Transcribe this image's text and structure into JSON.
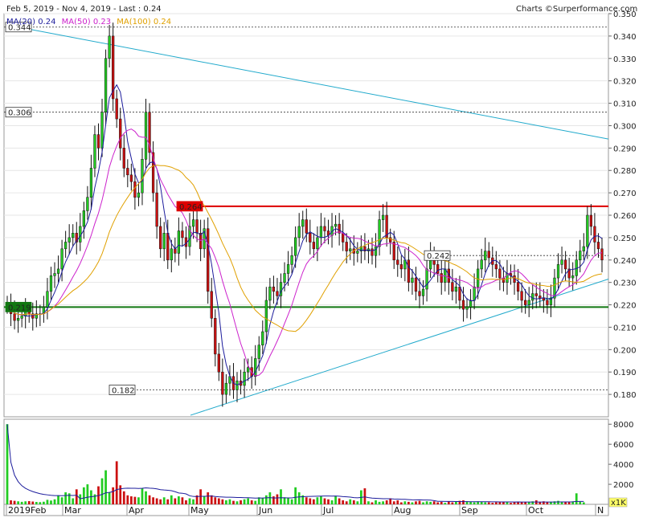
{
  "header": {
    "date_range": "Feb 5, 2019 - Nov 4, 2019 - Last : 0.24",
    "credit": "Charts",
    "site": "Surperformance.com",
    "ma20_label": "MA(20)",
    "ma20_value": "0.24",
    "ma50_label": "MA(50)",
    "ma50_value": "0.23",
    "ma100_label": "MA(100)",
    "ma100_value": "0.24"
  },
  "colors": {
    "ma20": "#1c1c9c",
    "ma50": "#cc22cc",
    "ma100": "#e0a000",
    "up_candle": "#22cc22",
    "down_candle": "#cc1111",
    "resistance": "#dd0000",
    "support": "#117711",
    "trend": "#22aacc"
  },
  "chart_data": {
    "type": "candlestick",
    "title": "Feb 5, 2019 - Nov 4, 2019 - Last : 0.24",
    "ylim": [
      0.17,
      0.35
    ],
    "y_ticks": [
      "0.350",
      "0.340",
      "0.330",
      "0.320",
      "0.310",
      "0.300",
      "0.290",
      "0.280",
      "0.270",
      "0.260",
      "0.250",
      "0.240",
      "0.230",
      "0.220",
      "0.210",
      "0.200",
      "0.190",
      "0.180"
    ],
    "x_labels": [
      "2019Feb",
      "Mar",
      "Apr",
      "May",
      "Jun",
      "Jul",
      "Aug",
      "Sep",
      "Oct",
      "N"
    ],
    "price_labels": [
      {
        "text": "0.344",
        "value": 0.344
      },
      {
        "text": "0.306",
        "value": 0.306
      },
      {
        "text": "0.264",
        "value": 0.264
      },
      {
        "text": "0.242",
        "value": 0.242
      },
      {
        "text": "0.219",
        "value": 0.219
      },
      {
        "text": "0.182",
        "value": 0.182
      }
    ],
    "close": [
      0.22,
      0.216,
      0.213,
      0.214,
      0.215,
      0.217,
      0.216,
      0.214,
      0.216,
      0.216,
      0.219,
      0.226,
      0.233,
      0.234,
      0.236,
      0.245,
      0.248,
      0.25,
      0.252,
      0.248,
      0.255,
      0.262,
      0.268,
      0.281,
      0.296,
      0.29,
      0.306,
      0.33,
      0.34,
      0.312,
      0.303,
      0.29,
      0.281,
      0.278,
      0.275,
      0.268,
      0.27,
      0.285,
      0.306,
      0.288,
      0.27,
      0.255,
      0.245,
      0.252,
      0.24,
      0.245,
      0.243,
      0.253,
      0.25,
      0.246,
      0.255,
      0.258,
      0.252,
      0.245,
      0.254,
      0.226,
      0.214,
      0.198,
      0.19,
      0.18,
      0.185,
      0.188,
      0.182,
      0.186,
      0.184,
      0.19,
      0.192,
      0.188,
      0.196,
      0.202,
      0.208,
      0.222,
      0.228,
      0.226,
      0.224,
      0.23,
      0.234,
      0.238,
      0.242,
      0.25,
      0.255,
      0.258,
      0.252,
      0.248,
      0.245,
      0.25,
      0.255,
      0.253,
      0.251,
      0.255,
      0.256,
      0.252,
      0.248,
      0.244,
      0.245,
      0.243,
      0.244,
      0.246,
      0.244,
      0.245,
      0.242,
      0.246,
      0.258,
      0.26,
      0.25,
      0.248,
      0.24,
      0.238,
      0.236,
      0.24,
      0.23,
      0.232,
      0.226,
      0.224,
      0.227,
      0.236,
      0.242,
      0.238,
      0.234,
      0.23,
      0.236,
      0.23,
      0.226,
      0.228,
      0.222,
      0.218,
      0.219,
      0.222,
      0.228,
      0.236,
      0.24,
      0.244,
      0.241,
      0.238,
      0.236,
      0.232,
      0.23,
      0.234,
      0.233,
      0.23,
      0.226,
      0.222,
      0.22,
      0.222,
      0.225,
      0.224,
      0.223,
      0.222,
      0.22,
      0.223,
      0.232,
      0.238,
      0.24,
      0.236,
      0.232,
      0.233,
      0.24,
      0.244,
      0.246,
      0.26,
      0.255,
      0.248,
      0.245,
      0.24
    ],
    "volume": [
      8000,
      400,
      350,
      300,
      250,
      300,
      320,
      280,
      240,
      220,
      260,
      450,
      380,
      500,
      900,
      700,
      1200,
      1100,
      600,
      1500,
      1000,
      1700,
      2000,
      1400,
      1000,
      1800,
      2600,
      3400,
      1200,
      1700,
      4300,
      1900,
      1300,
      900,
      800,
      750,
      700,
      1600,
      1300,
      900,
      700,
      600,
      500,
      700,
      500,
      900,
      600,
      800,
      700,
      400,
      600,
      500,
      900,
      1500,
      800,
      1200,
      900,
      700,
      600,
      500,
      400,
      500,
      350,
      300,
      400,
      500,
      600,
      400,
      350,
      700,
      600,
      900,
      1200,
      800,
      1000,
      1500,
      700,
      600,
      500,
      1700,
      1200,
      900,
      700,
      600,
      500,
      700,
      800,
      600,
      500,
      400,
      800,
      600,
      400,
      300,
      500,
      400,
      300,
      1400,
      1600,
      300,
      200,
      400,
      250,
      300,
      400,
      600,
      300,
      400,
      200,
      300,
      250,
      200,
      300,
      350,
      200,
      300,
      250,
      300,
      200,
      250,
      150,
      300,
      200,
      250,
      350,
      400,
      300,
      250,
      200,
      300,
      250,
      200,
      200,
      150,
      200,
      200,
      250,
      200,
      150,
      200,
      250,
      200,
      200,
      250,
      300,
      400,
      200,
      300,
      200,
      250,
      300,
      350,
      200,
      250,
      200,
      300,
      1100,
      250,
      200
    ]
  },
  "volume_axis": {
    "ticks": [
      "8000",
      "6000",
      "4000",
      "2000"
    ],
    "unit": "x1K"
  }
}
